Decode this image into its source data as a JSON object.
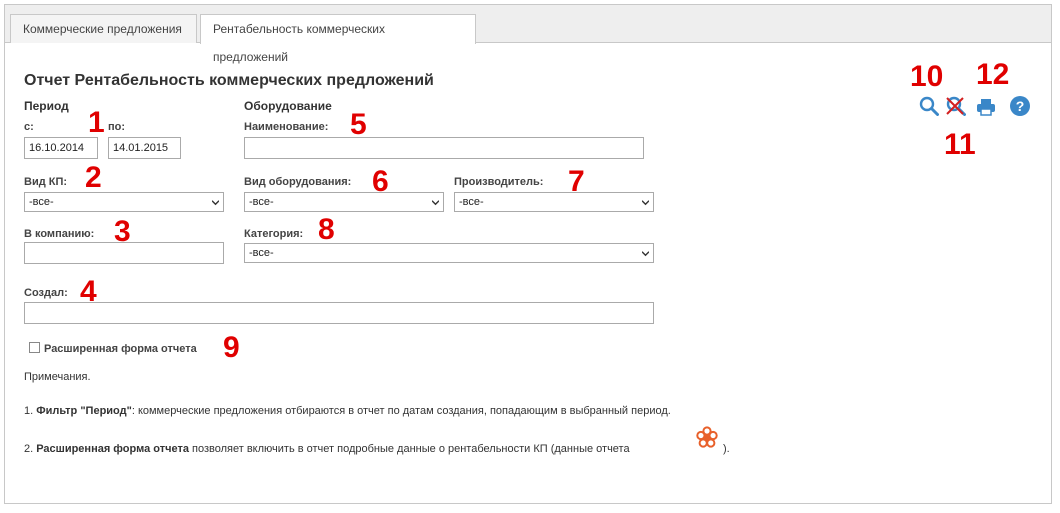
{
  "tabs": [
    {
      "label": "Коммерческие предложения"
    },
    {
      "label": "Рентабельность коммерческих предложений"
    }
  ],
  "page": {
    "title": "Отчет Рентабельность коммерческих предложений"
  },
  "period": {
    "heading": "Период",
    "from_label": "с:",
    "from_value": "16.10.2014",
    "to_label": "по:",
    "to_value": "14.01.2015"
  },
  "equipment": {
    "heading": "Оборудование",
    "name_label": "Наименование:",
    "name_value": "",
    "type_label": "Вид оборудования:",
    "type_value": "-все-",
    "manufacturer_label": "Производитель:",
    "manufacturer_value": "-все-",
    "category_label": "Категория:",
    "category_value": "-все-"
  },
  "filters": {
    "kp_type_label": "Вид КП:",
    "kp_type_value": "-все-",
    "company_label": "В компанию:",
    "company_value": "",
    "creator_label": "Создал:",
    "creator_value": "",
    "extended_label": "Расширенная форма отчета"
  },
  "annotations": {
    "n1": "1",
    "n2": "2",
    "n3": "3",
    "n4": "4",
    "n5": "5",
    "n6": "6",
    "n7": "7",
    "n8": "8",
    "n9": "9",
    "n10": "10",
    "n11": "11",
    "n12": "12"
  },
  "notes": {
    "heading": "Примечания.",
    "n1_prefix": "1. ",
    "n1_bold": "Фильтр \"Период\"",
    "n1_text": ": коммерческие предложения отбираются в отчет по датам создания, попадающим в выбранный период.",
    "n2_prefix": "2. ",
    "n2_bold": "Расширенная форма отчета",
    "n2_text": " позволяет включить в отчет подробные данные о рентабельности КП (данные отчета",
    "n2_suffix": ")."
  },
  "icons": {
    "search": "search-icon",
    "clear_search": "clear-search-icon",
    "print": "print-icon",
    "help": "help-icon",
    "flower": "flower-icon"
  },
  "colors": {
    "accent_blue": "#3a87c8",
    "annotation_red": "#e00000",
    "flower_orange": "#e8602a"
  }
}
